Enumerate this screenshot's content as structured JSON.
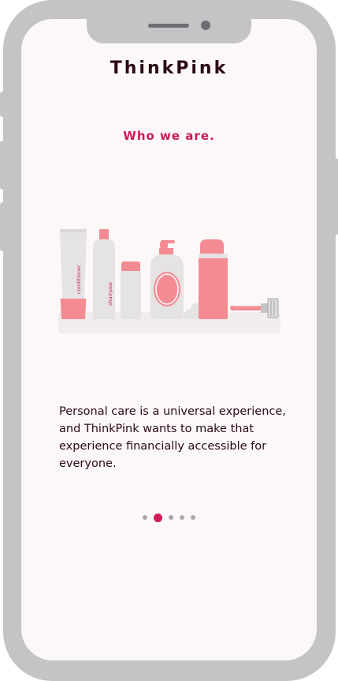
{
  "app": {
    "title": "ThinkPink"
  },
  "onboarding": {
    "heading": "Who we are.",
    "description": "Personal care is a universal experience, and ThinkPink wants to make that experience financially accessible for everyone.",
    "illustration": {
      "labels": {
        "conditioner": "conditioner",
        "shampoo": "shampoo"
      },
      "items": [
        "conditioner-tube",
        "shampoo-bottle",
        "deodorant",
        "soap-pump-bottle",
        "shaving-foam",
        "spray-can",
        "razor"
      ]
    },
    "pager": {
      "total": 5,
      "current": 2
    }
  },
  "colors": {
    "accent": "#cf1a5a",
    "text": "#2b0a14",
    "pink": "#f48b93",
    "product_gray": "#e6e3e3",
    "screen_bg": "#fcf8f7",
    "frame": "#c4c3c5"
  }
}
